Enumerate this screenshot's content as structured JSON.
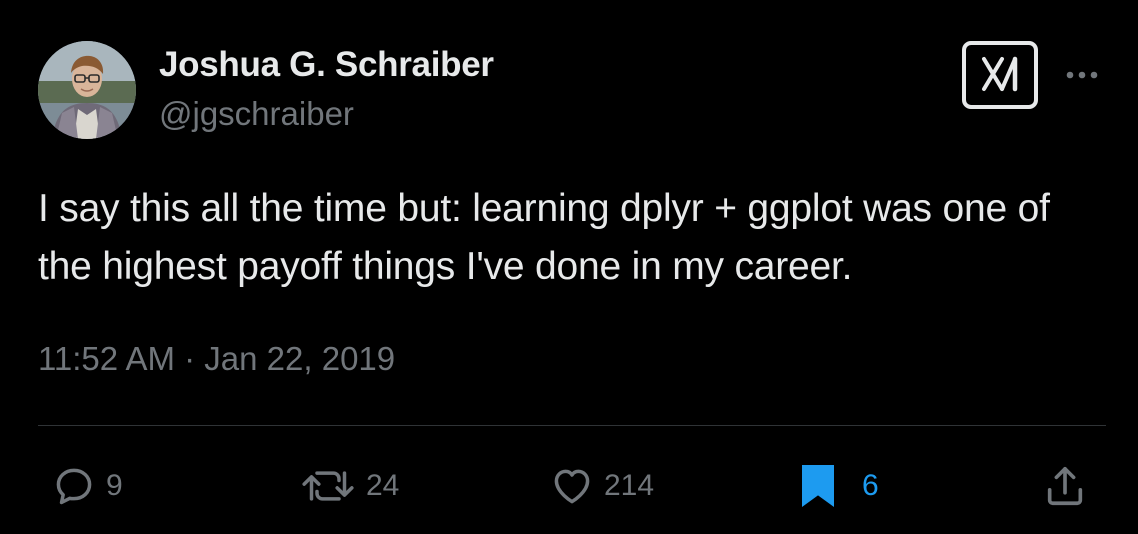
{
  "author": {
    "display_name": "Joshua G. Schraiber",
    "handle": "@jgschraiber",
    "avatar_icon": "profile-photo"
  },
  "header": {
    "logo_icon": "x-logo-icon",
    "more_icon": "more-horizontal-icon"
  },
  "tweet": {
    "text": "I say this all the time but: learning dplyr + ggplot was one of the highest payoff things I've done in my career.",
    "timestamp": "11:52 AM · Jan 22, 2019"
  },
  "actions": {
    "replies": "9",
    "retweets": "24",
    "likes": "214",
    "bookmarks": "6"
  },
  "colors": {
    "background": "#000000",
    "primary_text": "#e7e9ea",
    "secondary_text": "#71767b",
    "accent": "#1d9bf0",
    "divider": "#2f3336"
  }
}
